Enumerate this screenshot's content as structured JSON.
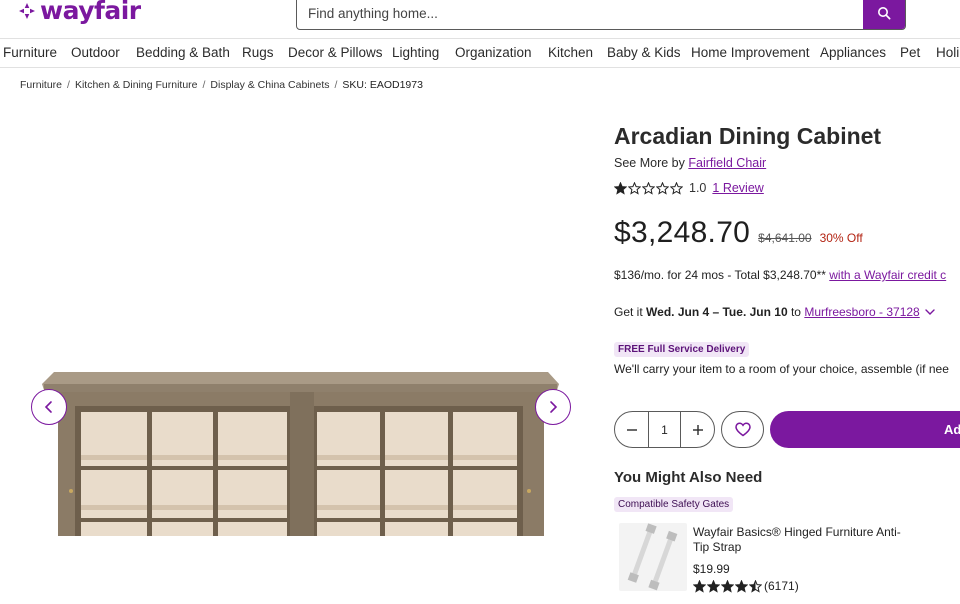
{
  "brand": {
    "name": "wayfair",
    "color": "#7b189f"
  },
  "search": {
    "placeholder": "Find anything home...",
    "icon": "search-icon"
  },
  "nav": {
    "items": [
      "Furniture",
      "Outdoor",
      "Bedding & Bath",
      "Rugs",
      "Decor & Pillows",
      "Lighting",
      "Organization",
      "Kitchen",
      "Baby & Kids",
      "Home Improvement",
      "Appliances",
      "Pet",
      "Holi"
    ]
  },
  "breadcrumb": {
    "items": [
      "Furniture",
      "Kitchen & Dining Furniture",
      "Display & China Cabinets"
    ],
    "sku": "SKU: EAOD1973"
  },
  "gallery": {
    "prev_icon": "chevron-left-icon",
    "next_icon": "chevron-right-icon"
  },
  "product": {
    "title": "Arcadian Dining Cabinet",
    "see_more_prefix": "See More by",
    "brand_link": "Fairfield Chair",
    "rating_value": "1.0",
    "rating_stars": 1,
    "rating_max": 5,
    "reviews_link": "1 Review",
    "price": "$3,248.70",
    "original_price": "$4,641.00",
    "discount": "30% Off",
    "financing_text": "$136/mo. for 24 mos - Total $3,248.70**",
    "financing_link": "with a Wayfair credit c",
    "delivery_prefix": "Get it",
    "delivery_dates": "Wed. Jun 4 – Tue. Jun 10",
    "delivery_to": "to",
    "delivery_location": "Murfreesboro - 37128",
    "delivery_badge": "FREE Full Service Delivery",
    "delivery_description": "We'll carry your item to a room of your choice, assemble (if nee",
    "quantity": "1",
    "add_to_cart_label": "Ad"
  },
  "also_need": {
    "heading": "You Might Also Need",
    "badge": "Compatible Safety Gates",
    "item": {
      "name": "Wayfair Basics® Hinged Furniture Anti-Tip Strap",
      "price": "$19.99",
      "rating": 4.5,
      "review_count": "(6171)"
    }
  }
}
